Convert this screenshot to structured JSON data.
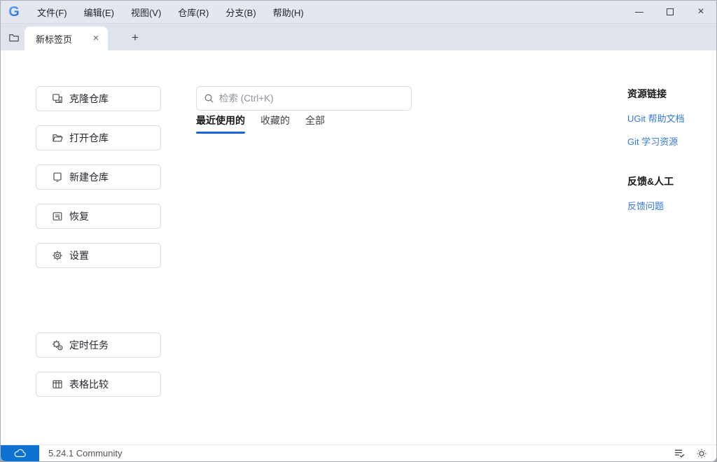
{
  "titlebar": {
    "menus": [
      "文件(F)",
      "编辑(E)",
      "视图(V)",
      "仓库(R)",
      "分支(B)",
      "帮助(H)"
    ],
    "close_glyph": "×"
  },
  "tabbar": {
    "active_tab_label": "新标签页",
    "tab_close_glyph": "×",
    "new_tab_glyph": "+"
  },
  "sidebar": {
    "buttons": [
      {
        "label": "克隆仓库",
        "icon": "clone-repo-icon"
      },
      {
        "label": "打开仓库",
        "icon": "open-repo-icon"
      },
      {
        "label": "新建仓库",
        "icon": "new-repo-icon"
      },
      {
        "label": "恢复",
        "icon": "restore-icon"
      },
      {
        "label": "设置",
        "icon": "settings-icon"
      }
    ],
    "tools": [
      {
        "label": "定时任务",
        "icon": "scheduled-task-icon"
      },
      {
        "label": "表格比较",
        "icon": "table-compare-icon"
      }
    ]
  },
  "main": {
    "search_placeholder": "检索 (Ctrl+K)",
    "filter_tabs": [
      {
        "label": "最近使用的",
        "active": true
      },
      {
        "label": "收藏的",
        "active": false
      },
      {
        "label": "全部",
        "active": false
      }
    ]
  },
  "resources": {
    "links_heading": "资源链接",
    "links": [
      {
        "label": "UGit 帮助文档"
      },
      {
        "label": "Git 学习资源"
      }
    ],
    "feedback_heading": "反馈&人工",
    "feedback_links": [
      {
        "label": "反馈问题"
      }
    ]
  },
  "statusbar": {
    "version": "5.24.1 Community"
  },
  "colors": {
    "accent_blue": "#1764d9",
    "link_blue": "#3478d8",
    "status_badge_blue": "#0e72d2",
    "titlebar_bg": "#e4e7ee",
    "tabbar_bg": "#dfe3ec"
  }
}
